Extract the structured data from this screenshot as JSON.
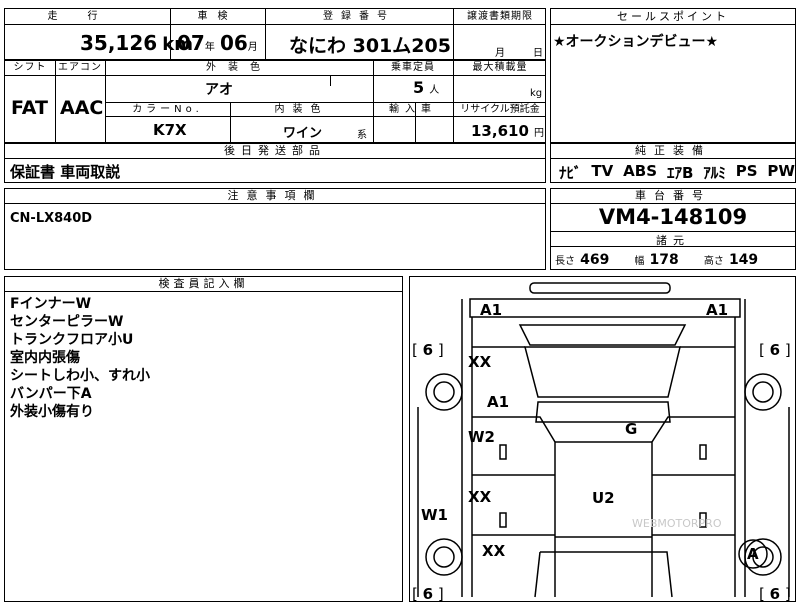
{
  "top": {
    "mileage_label": "走行",
    "mileage": "35,126",
    "mileage_unit": "km",
    "inspection_label": "車検",
    "inspection_year": "07",
    "inspection_year_unit": "年",
    "inspection_month": "06",
    "inspection_month_unit": "月",
    "registration_label": "登録番号",
    "registration": "なにわ 301ム205",
    "transfer_label": "譲渡書類期限",
    "transfer_month_unit": "月",
    "transfer_day_unit": "日"
  },
  "row2": {
    "shift_label": "シフト",
    "shift": "FAT",
    "ac_label": "エアコン",
    "ac": "AAC",
    "exterior_color_label": "外装色",
    "exterior_color": "アオ",
    "capacity_label": "乗車定員",
    "capacity": "5",
    "capacity_unit": "人",
    "max_load_label": "最大積載量",
    "max_load_unit": "kg",
    "color_no_label": "カラーNo.",
    "color_no": "K7X",
    "interior_color_label": "内装色",
    "interior_color": "ワイン",
    "interior_suffix": "系",
    "import_label": "輸入車",
    "recycle_label": "リサイクル預託金",
    "recycle_fee": "13,610",
    "recycle_unit": "円"
  },
  "shipping": {
    "label": "後日発送部品",
    "value": "保証書 車両取説"
  },
  "sales_point": {
    "label": "セールスポイント",
    "value": "★オークションデビュー★"
  },
  "equipment": {
    "label": "純正装備",
    "items": [
      "ﾅﾋﾞ",
      "TV",
      "ABS",
      "ｴｱB",
      "ｱﾙﾐ",
      "PS",
      "PW"
    ]
  },
  "notes": {
    "label": "注意事項欄",
    "value": "CN-LX840D"
  },
  "chassis": {
    "label": "車台番号",
    "value": "VM4-148109",
    "spec_label": "諸元",
    "length_label": "長さ",
    "length": "469",
    "width_label": "幅",
    "width": "178",
    "height_label": "高さ",
    "height": "149"
  },
  "inspector": {
    "label": "検査員記入欄",
    "lines": [
      "FインナーW",
      "センターピラーW",
      "トランクフロア小U",
      "室内内張傷",
      "シートしわ小、すれ小",
      "バンパー下A",
      "外装小傷有り"
    ]
  },
  "diagram": {
    "front_left": "A1",
    "front_right": "A1",
    "tire_fl": "6",
    "tire_fr": "6",
    "tire_rl": "6",
    "tire_rr": "6",
    "mark_xx1": "XX",
    "mark_a1": "A1",
    "mark_w2": "W2",
    "mark_g": "G",
    "mark_xx2": "XX",
    "mark_u2": "U2",
    "mark_w1": "W1",
    "mark_xx3": "XX",
    "mark_a": "A",
    "watermark": "WEBMOTORPRO"
  }
}
